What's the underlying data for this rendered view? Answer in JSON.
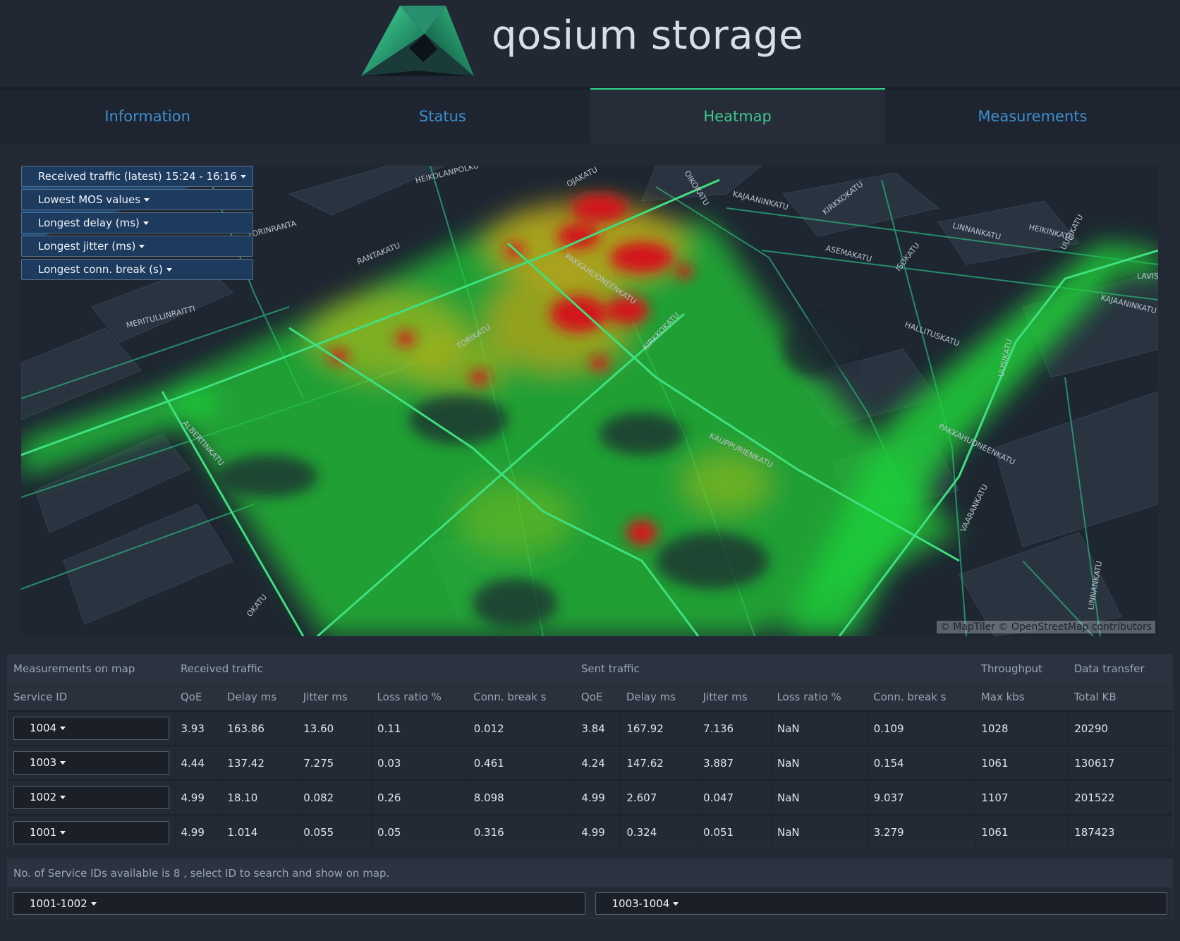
{
  "header": {
    "brand": "qosium storage"
  },
  "tabs": [
    {
      "label": "Information",
      "active": false
    },
    {
      "label": "Status",
      "active": false
    },
    {
      "label": "Heatmap",
      "active": true
    },
    {
      "label": "Measurements",
      "active": false
    }
  ],
  "map": {
    "controls": [
      "Received traffic (latest) 15:24 - 16:16",
      "Lowest MOS values",
      "Longest delay (ms)",
      "Longest jitter (ms)",
      "Longest conn. break (s)"
    ],
    "attribution": "© MapTiler © OpenStreetMap contributors",
    "street_labels": [
      "HEIKOLANPOLKU",
      "TORINRANTA",
      "RANTAKATU",
      "MERITULLINRAITTI",
      "ALBERTINKATU",
      "OJAKATU",
      "OIKOKATU",
      "KAJAANINKATU",
      "KIRKKOKATU",
      "HEIKINKATU",
      "LINNANKATU",
      "ASEMAKATU",
      "ISOKATU",
      "UUSIKATU",
      "KAJAANINKATU",
      "HALLITUSKATU",
      "PAKKAHUONEENKATU",
      "TORIKATU",
      "KIRKKOKATU",
      "KAUPPURIENKATU",
      "PAKKAHUONEENKATU",
      "VAARANKATU",
      "LINNANKATU",
      "UUSIKATU",
      "OKATU",
      "LAVIS"
    ],
    "colors": {
      "heat_low": "#1fe03b",
      "heat_mid": "#c9b81a",
      "heat_high": "#d2151f",
      "road": "#2fbf7c"
    }
  },
  "table": {
    "group_headers": {
      "measurements": "Measurements on map",
      "received": "Received traffic",
      "sent": "Sent traffic",
      "throughput": "Throughput",
      "data_transfer": "Data transfer"
    },
    "columns": [
      "Service ID",
      "QoE",
      "Delay ms",
      "Jitter ms",
      "Loss ratio %",
      "Conn. break s",
      "QoE",
      "Delay ms",
      "Jitter ms",
      "Loss ratio %",
      "Conn. break s",
      "Max kbs",
      "Total KB"
    ],
    "rows": [
      [
        "1004",
        "3.93",
        "163.86",
        "13.60",
        "0.11",
        "0.012",
        "3.84",
        "167.92",
        "7.136",
        "NaN",
        "0.109",
        "1028",
        "20290"
      ],
      [
        "1003",
        "4.44",
        "137.42",
        "7.275",
        "0.03",
        "0.461",
        "4.24",
        "147.62",
        "3.887",
        "NaN",
        "0.154",
        "1061",
        "130617"
      ],
      [
        "1002",
        "4.99",
        "18.10",
        "0.082",
        "0.26",
        "8.098",
        "4.99",
        "2.607",
        "0.047",
        "NaN",
        "9.037",
        "1107",
        "201522"
      ],
      [
        "1001",
        "4.99",
        "1.014",
        "0.055",
        "0.05",
        "0.316",
        "4.99",
        "0.324",
        "0.051",
        "NaN",
        "3.279",
        "1061",
        "187423"
      ]
    ]
  },
  "bottom": {
    "label": "No. of Service IDs available is 8 , select ID to search and show on map.",
    "ranges": [
      "1001-1002",
      "1003-1004"
    ]
  }
}
